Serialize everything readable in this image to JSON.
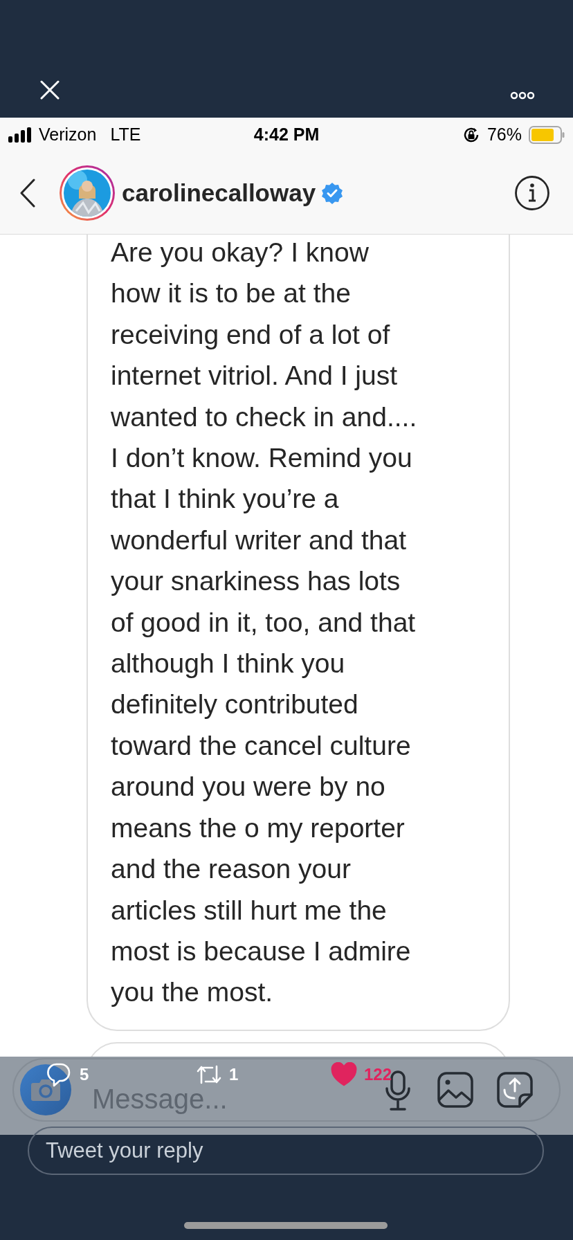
{
  "status_bar": {
    "carrier": "Verizon",
    "network": "LTE",
    "time": "4:42 PM",
    "battery": "76%"
  },
  "chat_header": {
    "username": "carolinecalloway",
    "verified": true
  },
  "message": {
    "lines": [
      "Are you okay? I know",
      "how it is to be at the",
      "receiving end of a lot of",
      "internet vitriol. And I just",
      "wanted to check in and....",
      "I don’t know. Remind you",
      "that I think you’re a",
      "wonderful writer and that",
      "your snarkiness has lots",
      "of good in it, too, and that",
      "although I think you",
      "definitely contributed",
      "toward the cancel culture",
      "around you were by no",
      "means the o my reporter",
      "and the reason your",
      "articles still hurt me the",
      "most is because I admire",
      "you the most."
    ]
  },
  "composer": {
    "placeholder": "Message..."
  },
  "tweet_actions": [
    {
      "kind": "reply",
      "count": "5",
      "selected": false
    },
    {
      "kind": "retweet",
      "count": "1",
      "selected": false
    },
    {
      "kind": "like",
      "count": "122",
      "selected": true
    }
  ],
  "reply_field": {
    "placeholder": "Tweet your reply"
  }
}
